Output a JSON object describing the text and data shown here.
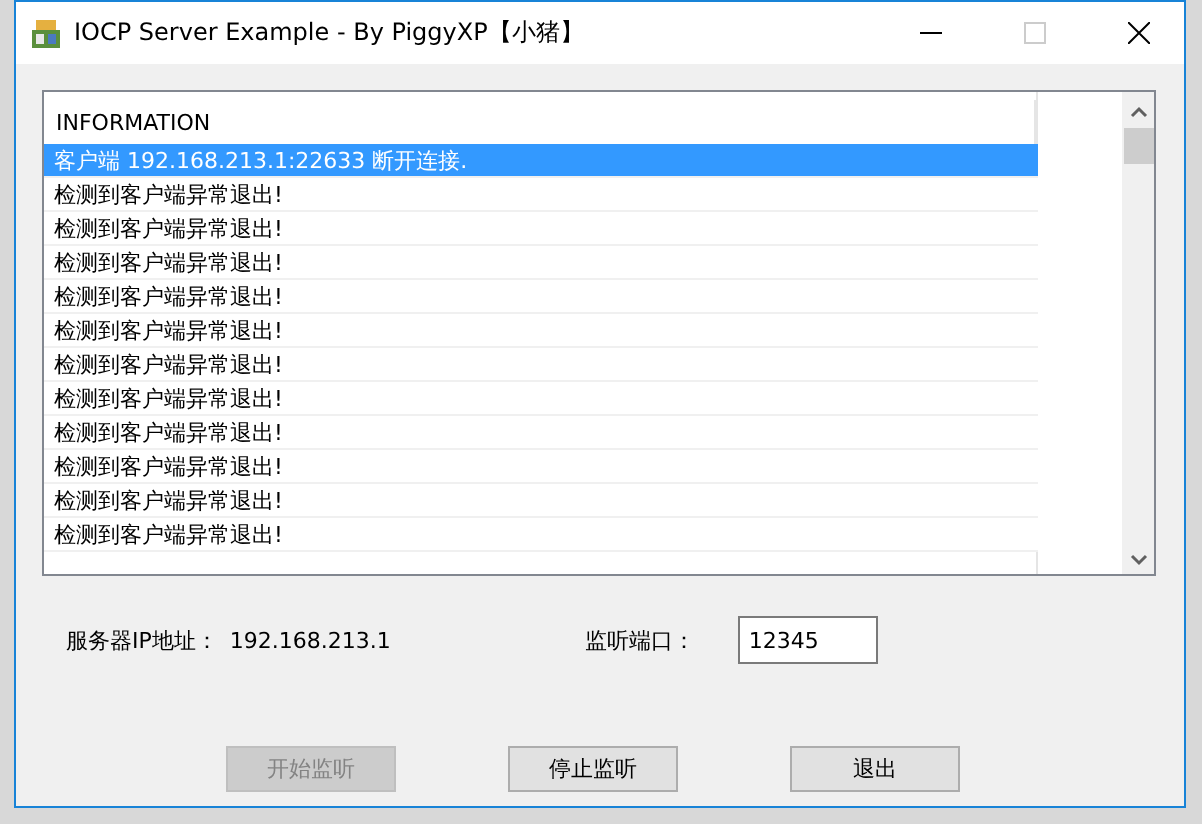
{
  "window": {
    "title": "IOCP Server Example - By PiggyXP【小猪】"
  },
  "log": {
    "column": "INFORMATION",
    "rows": [
      {
        "text": "客户端 192.168.213.1:22633 断开连接.",
        "selected": true
      },
      {
        "text": "检测到客户端异常退出!",
        "selected": false
      },
      {
        "text": "检测到客户端异常退出!",
        "selected": false
      },
      {
        "text": "检测到客户端异常退出!",
        "selected": false
      },
      {
        "text": "检测到客户端异常退出!",
        "selected": false
      },
      {
        "text": "检测到客户端异常退出!",
        "selected": false
      },
      {
        "text": "检测到客户端异常退出!",
        "selected": false
      },
      {
        "text": "检测到客户端异常退出!",
        "selected": false
      },
      {
        "text": "检测到客户端异常退出!",
        "selected": false
      },
      {
        "text": "检测到客户端异常退出!",
        "selected": false
      },
      {
        "text": "检测到客户端异常退出!",
        "selected": false
      },
      {
        "text": "检测到客户端异常退出!",
        "selected": false
      }
    ]
  },
  "server_ip": {
    "label": "服务器IP地址：",
    "value": "192.168.213.1"
  },
  "port": {
    "label": "监听端口：",
    "value": "12345"
  },
  "buttons": [
    {
      "label": "开始监听",
      "disabled": true
    },
    {
      "label": "停止监听",
      "disabled": false
    },
    {
      "label": "退出",
      "disabled": false
    }
  ]
}
